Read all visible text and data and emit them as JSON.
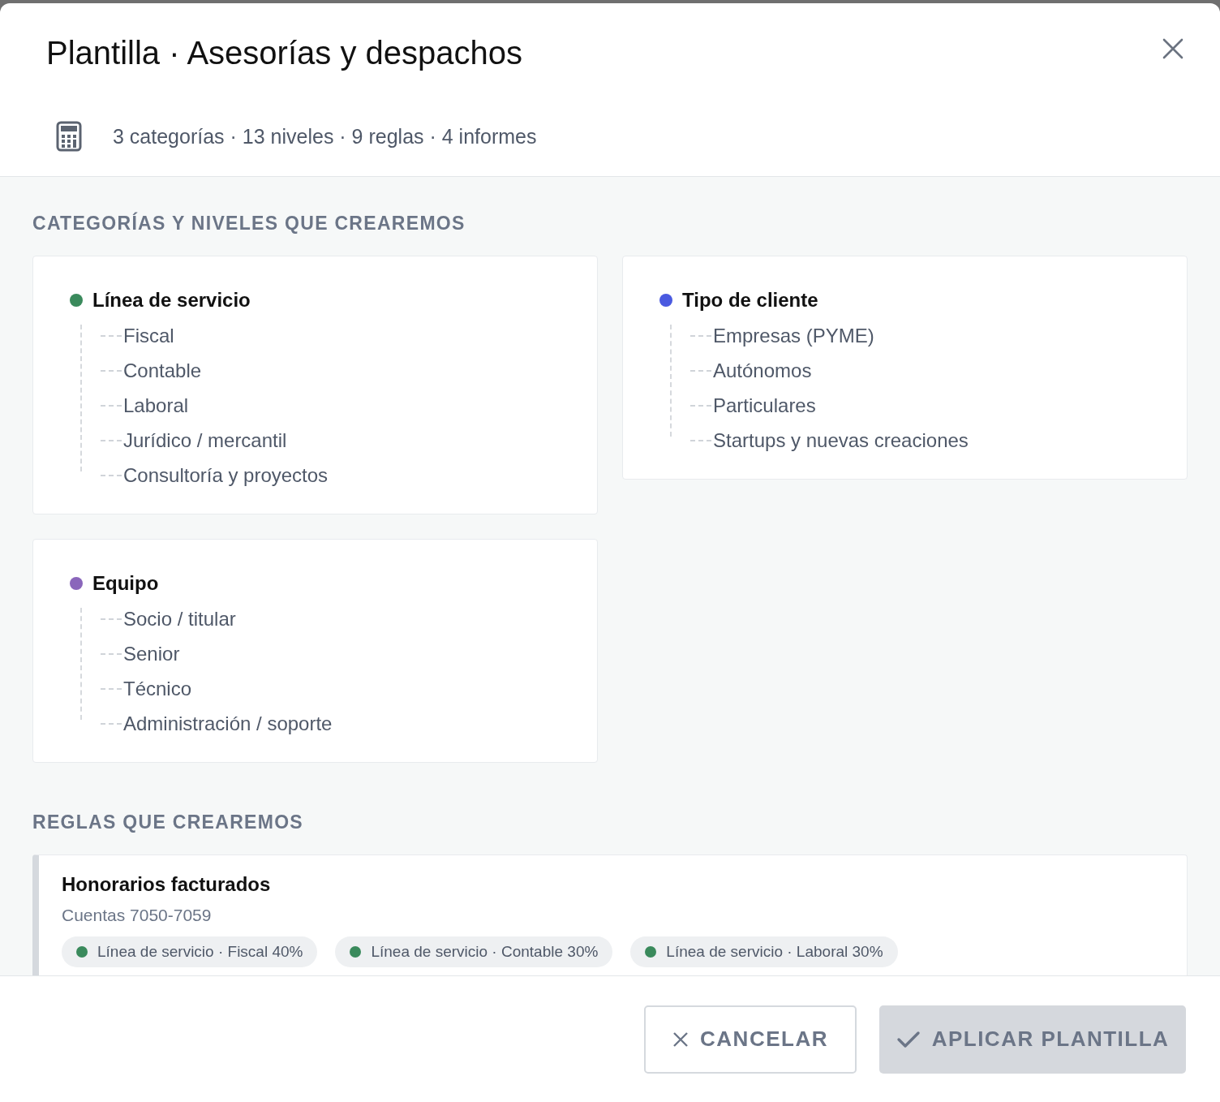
{
  "dialog": {
    "title": "Plantilla · Asesorías y despachos",
    "summary": "3 categorías · 13 niveles · 9 reglas · 4 informes"
  },
  "categories_section": {
    "heading": "CATEGORÍAS Y NIVELES QUE CREAREMOS",
    "categories": [
      {
        "name": "Línea de servicio",
        "color": "#3a8a5c",
        "children": [
          {
            "name": "Fiscal"
          },
          {
            "name": "Contable"
          },
          {
            "name": "Laboral"
          },
          {
            "name": "Jurídico / mercantil"
          },
          {
            "name": "Consultoría y proyectos"
          }
        ]
      },
      {
        "name": "Tipo de cliente",
        "color": "#4a5ae0",
        "children": [
          {
            "name": "Empresas (PYME)"
          },
          {
            "name": "Autónomos"
          },
          {
            "name": "Particulares"
          },
          {
            "name": "Startups y nuevas creaciones"
          }
        ]
      },
      {
        "name": "Equipo",
        "color": "#8a66bb",
        "children": [
          {
            "name": "Socio / titular"
          },
          {
            "name": "Senior"
          },
          {
            "name": "Técnico"
          },
          {
            "name": "Administración / soporte"
          }
        ]
      }
    ]
  },
  "rules_section": {
    "heading": "REGLAS QUE CREAREMOS",
    "rules": [
      {
        "name": "Honorarios facturados",
        "accounts": "Cuentas 7050-7059",
        "splits": [
          {
            "label": "Línea de servicio · Fiscal 40%",
            "color": "#3a8a5c"
          },
          {
            "label": "Línea de servicio · Contable 30%",
            "color": "#3a8a5c"
          },
          {
            "label": "Línea de servicio · Laboral 30%",
            "color": "#3a8a5c"
          }
        ]
      }
    ]
  },
  "footer": {
    "cancel": "CANCELAR",
    "apply": {
      "label": "APLICAR PLANTILLA",
      "disabled": true
    }
  }
}
